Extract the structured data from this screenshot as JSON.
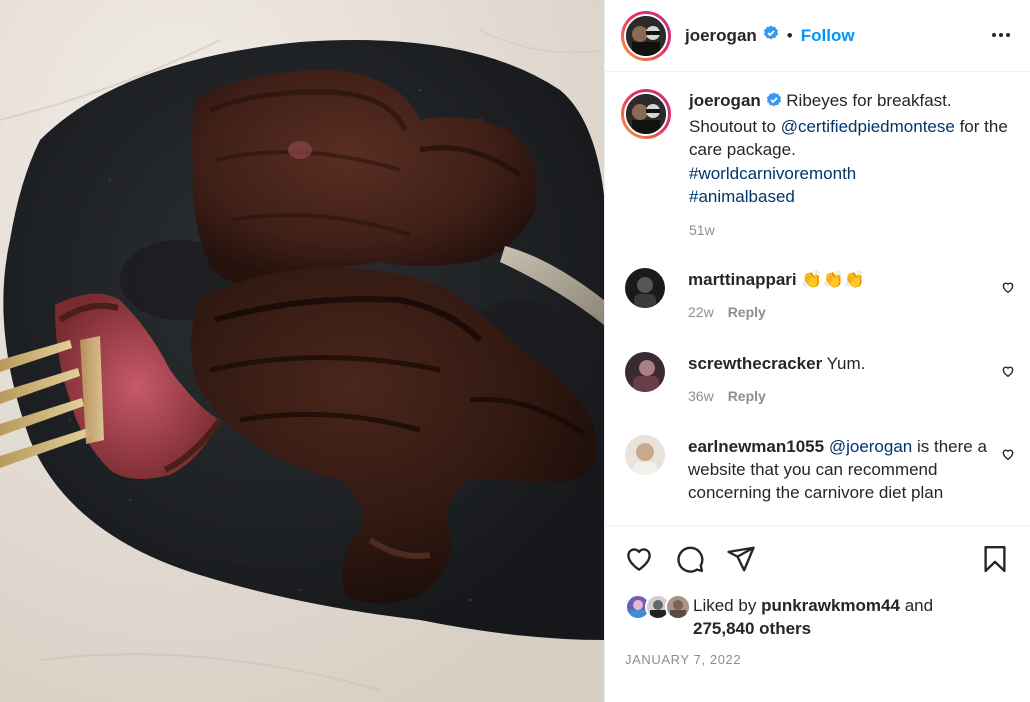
{
  "post": {
    "image_alt": "Ribeye steaks on a black plate",
    "author": "joerogan",
    "follow_label": "Follow",
    "separator": "•"
  },
  "caption": {
    "author": "joerogan",
    "text_1": "Ribeyes for breakfast. Shoutout to",
    "mention": "@certifiedpiedmontese",
    "text_2": "for the care package.",
    "hashtag_1": "#worldcarnivoremonth",
    "hashtag_2": "#animalbased",
    "time": "51w"
  },
  "comments": [
    {
      "user": "marttinappari",
      "text": "👏👏👏",
      "time": "22w",
      "reply": "Reply"
    },
    {
      "user": "screwthecracker",
      "text": "Yum.",
      "time": "36w",
      "reply": "Reply"
    },
    {
      "user": "earlnewman1055",
      "mention": "@joerogan",
      "text": "is there a website that you can recommend concerning the carnivore diet plan"
    }
  ],
  "likes": {
    "prefix": "Liked by",
    "user": "punkrawkmom44",
    "and": "and",
    "count": "275,840 others"
  },
  "date": "JANUARY 7, 2022",
  "icons": [
    "verified-badge-icon",
    "more-options-icon",
    "heart-icon",
    "comment-icon",
    "share-icon",
    "bookmark-icon"
  ],
  "colors": {
    "accent": "#0095f6",
    "link": "#00376b",
    "muted": "#8e8e8e",
    "verified": "#3897f0"
  }
}
